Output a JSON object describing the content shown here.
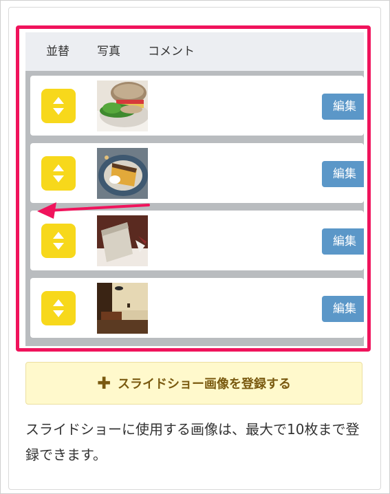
{
  "table": {
    "headers": {
      "sort": "並替",
      "photo": "写真",
      "comment": "コメント"
    },
    "rows": [
      {
        "thumb": "sandwich-photo",
        "edit_label": "編集"
      },
      {
        "thumb": "cake-slice-photo",
        "edit_label": "編集"
      },
      {
        "thumb": "chiffon-cake-photo",
        "edit_label": "編集"
      },
      {
        "thumb": "cafe-interior-photo",
        "edit_label": "編集"
      }
    ]
  },
  "register_button": {
    "icon": "plus-icon",
    "label": "スライドショー画像を登録する"
  },
  "note": "スライドショーに使用する画像は、最大で10枚まで登録できます。",
  "colors": {
    "highlight": "#f0135c",
    "sort_button": "#f7d81b",
    "edit_button": "#5b97c8",
    "register_bg": "#fff9cc",
    "register_text": "#7a5a10",
    "arrow": "#f0135c"
  }
}
